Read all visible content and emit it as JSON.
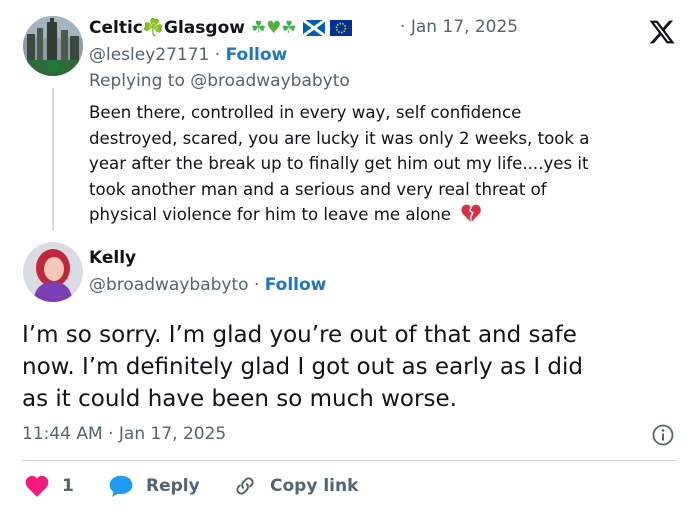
{
  "parent": {
    "display_name": "Celtic☘️Glasgow",
    "handle": "@lesley27171",
    "follow_label": "Follow",
    "date": "Jan 17, 2025",
    "replying_prefix": "Replying to",
    "replying_handle": "@broadwaybabyto",
    "body_lines": [
      "Been there, controlled in every way, self confidence",
      "destroyed, scared, you are lucky it was only 2 weeks, took a",
      "year after the break up to finally get him out my life....yes it",
      "took another man and a serious and very real threat of",
      "physical violence for him to leave me alone"
    ]
  },
  "main": {
    "display_name": "Kelly",
    "handle": "@broadwaybabyto",
    "follow_label": "Follow",
    "body_lines": [
      "I’m so sorry. I’m glad you’re out of that and safe",
      "now. I’m definitely glad I got out as early as I did",
      "as it could have been so much worse."
    ],
    "timestamp": "11:44 AM · Jan 17, 2025"
  },
  "actions": {
    "like_count": "1",
    "reply_label": "Reply",
    "copy_link_label": "Copy link"
  },
  "icons": {
    "brand": "x-logo-icon",
    "info": "info-icon",
    "like": "heart-icon",
    "reply": "reply-bubble-icon",
    "copy": "link-icon",
    "broken_heart": "broken-heart-emoji"
  },
  "colors": {
    "text": "#0f1419",
    "muted": "#536471",
    "follow": "#1d74c9",
    "like": "#f91880",
    "reply": "#1d9bf0",
    "divider": "#cfd9de"
  }
}
